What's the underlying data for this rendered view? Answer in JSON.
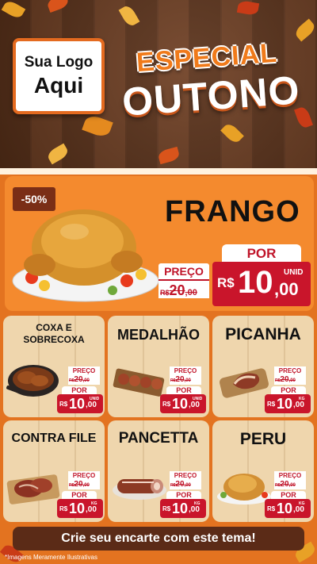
{
  "brand": {
    "accent": "#e37320",
    "price_red": "#c9152b",
    "wood": "#5a3119"
  },
  "logo": {
    "line1": "Sua Logo",
    "line2": "Aqui"
  },
  "title": {
    "line1": "ESPECIAL",
    "line2": "OUTONO"
  },
  "featured": {
    "discount": "-50%",
    "name": "FRANGO",
    "preco_label": "PREÇO",
    "old_currency": "R$",
    "old_int": "20",
    "old_dec": ",00",
    "por_label": "POR",
    "currency": "R$",
    "price_int": "10",
    "price_dec": ",00",
    "unit": "UNID"
  },
  "products": [
    {
      "name_l1": "COXA E",
      "name_l2": "SOBRECOXA",
      "preco_label": "PREÇO",
      "old_currency": "R$",
      "old_int": "20",
      "old_dec": ",00",
      "por_label": "POR",
      "currency": "R$",
      "price_int": "10",
      "price_dec": ",00",
      "unit": "UNID",
      "icon": "chicken-legs-pan-icon"
    },
    {
      "name_l1": "MEDALHÃO",
      "name_l2": "",
      "preco_label": "PREÇO",
      "old_currency": "R$",
      "old_int": "20",
      "old_dec": ",00",
      "por_label": "POR",
      "currency": "R$",
      "price_int": "10",
      "price_dec": ",00",
      "unit": "UNID",
      "icon": "medallion-skewers-icon"
    },
    {
      "name_l1": "PICANHA",
      "name_l2": "",
      "preco_label": "PREÇO",
      "old_currency": "R$",
      "old_int": "20",
      "old_dec": ",00",
      "por_label": "POR",
      "currency": "R$",
      "price_int": "10",
      "price_dec": ",00",
      "unit": "KG",
      "icon": "picanha-board-icon"
    },
    {
      "name_l1": "CONTRA FILE",
      "name_l2": "",
      "preco_label": "PREÇO",
      "old_currency": "R$",
      "old_int": "20",
      "old_dec": ",00",
      "por_label": "POR",
      "currency": "R$",
      "price_int": "10",
      "price_dec": ",00",
      "unit": "KG",
      "icon": "steak-board-icon"
    },
    {
      "name_l1": "PANCETTA",
      "name_l2": "",
      "preco_label": "PREÇO",
      "old_currency": "R$",
      "old_int": "20",
      "old_dec": ",00",
      "por_label": "POR",
      "currency": "R$",
      "price_int": "10",
      "price_dec": ",00",
      "unit": "KG",
      "icon": "pancetta-roll-icon"
    },
    {
      "name_l1": "PERU",
      "name_l2": "",
      "preco_label": "PREÇO",
      "old_currency": "R$",
      "old_int": "20",
      "old_dec": ",00",
      "por_label": "POR",
      "currency": "R$",
      "price_int": "10",
      "price_dec": ",00",
      "unit": "KG",
      "icon": "roast-turkey-icon"
    }
  ],
  "footer": {
    "cta": "Crie seu encarte com este tema!",
    "note": "*Imagens Meramente Ilustrativas"
  }
}
